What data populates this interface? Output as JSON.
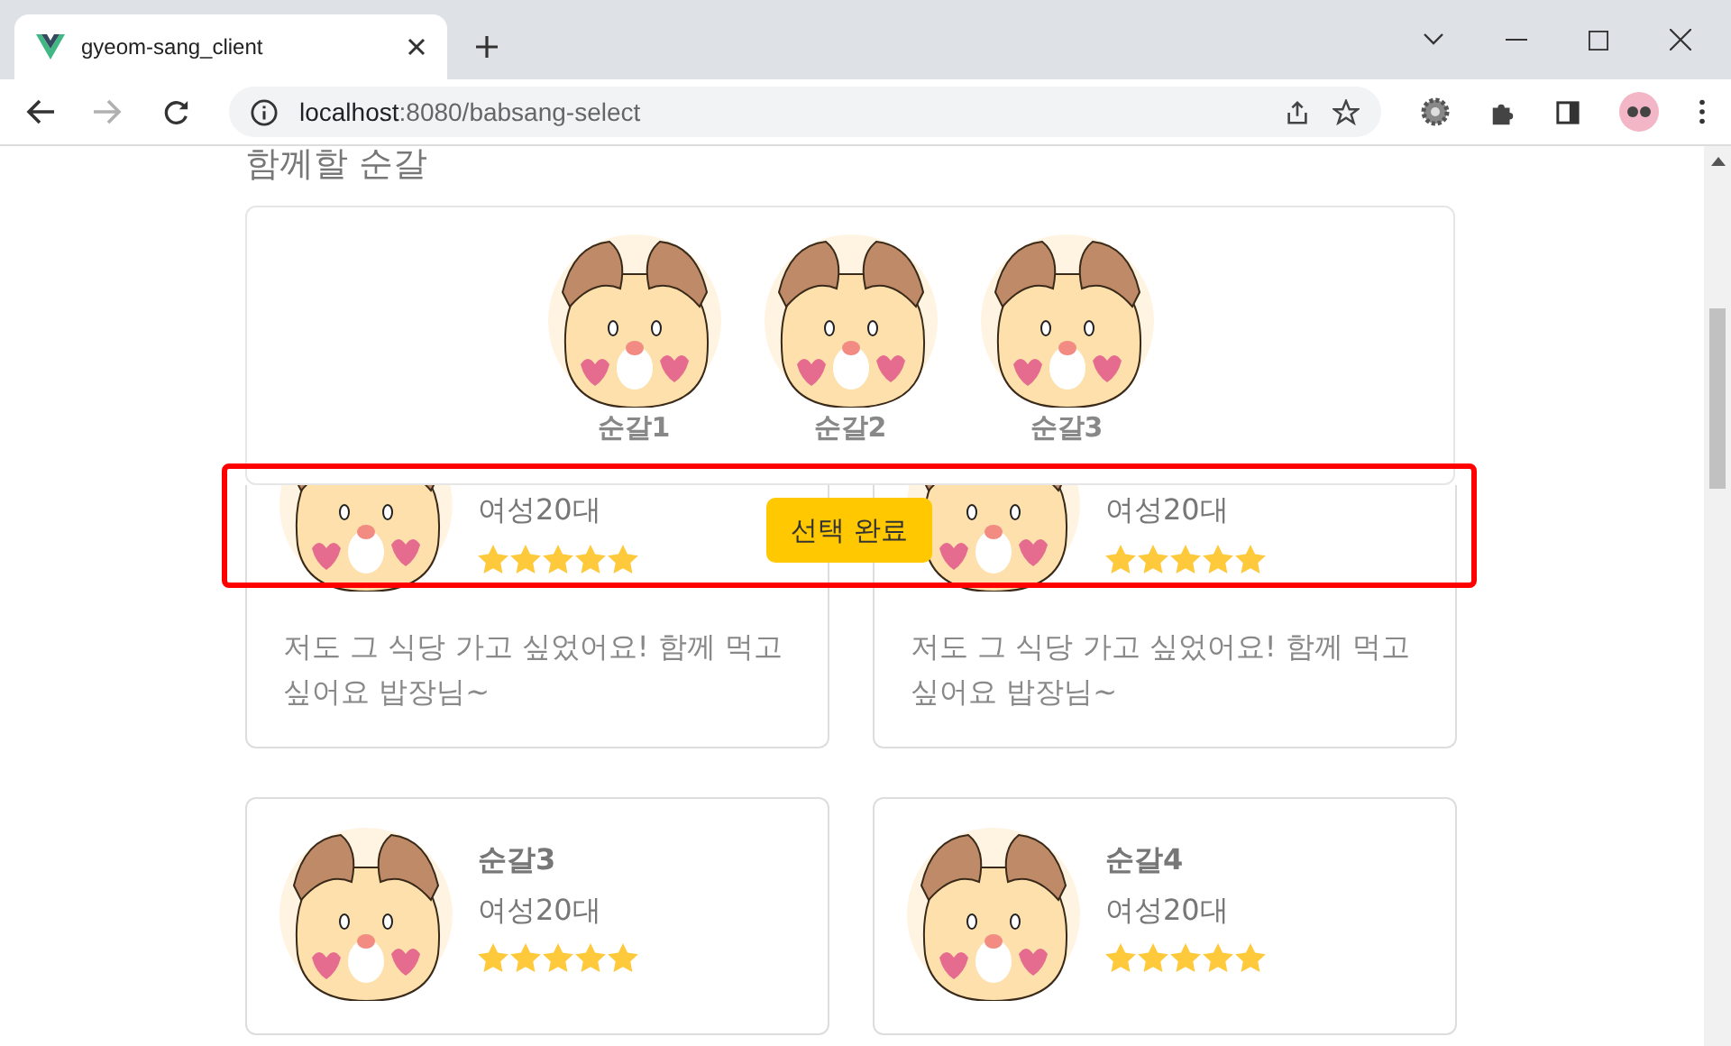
{
  "browser": {
    "tab_title": "gyeom-sang_client",
    "forward_disabled": true,
    "url": {
      "host": "localhost",
      "path": ":8080/babsang-select"
    }
  },
  "section_title": "함께할 순갈",
  "selected_panel": {
    "members": [
      {
        "name": "순갈1"
      },
      {
        "name": "순갈2"
      },
      {
        "name": "순갈3"
      }
    ]
  },
  "confirm_button": "선택 완료",
  "cards": [
    {
      "kind": "cut",
      "age_group": "여성20대",
      "stars": 5,
      "comment": "저도 그 식당 가고 싶었어요! 함께 먹고 싶어요 밥장님~"
    },
    {
      "kind": "cut",
      "age_group": "여성20대",
      "stars": 5,
      "comment": "저도 그 식당 가고 싶었어요! 함께 먹고 싶어요 밥장님~"
    },
    {
      "kind": "full",
      "name": "순갈3",
      "age_group": "여성20대",
      "stars": 5
    },
    {
      "kind": "full",
      "name": "순갈4",
      "age_group": "여성20대",
      "stars": 5
    }
  ]
}
